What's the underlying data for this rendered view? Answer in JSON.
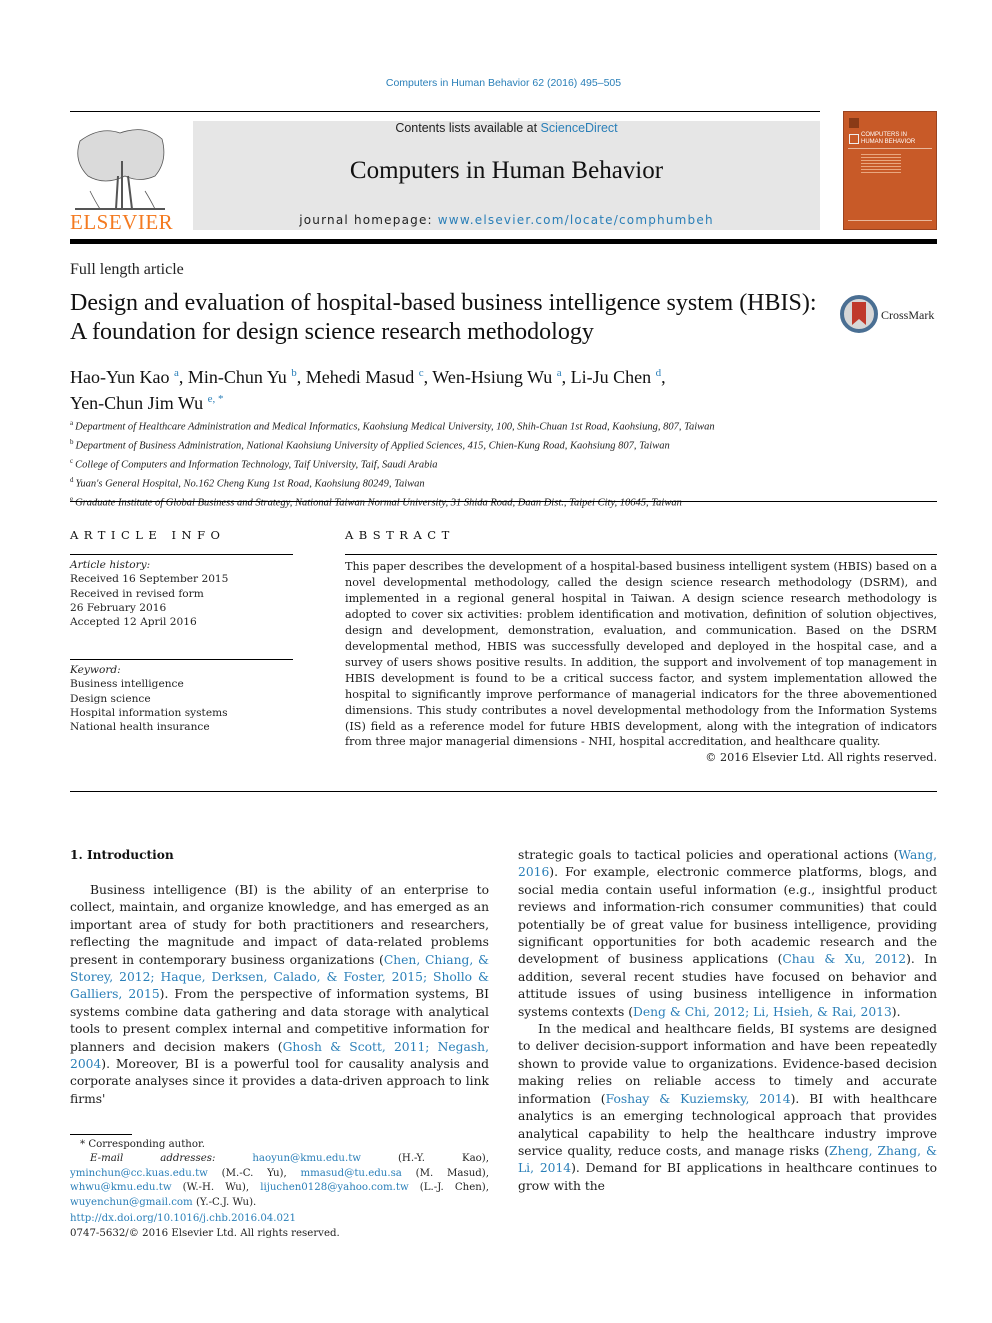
{
  "header": {
    "journal_reference": "Computers in Human Behavior 62 (2016) 495–505",
    "contents_prefix": "Contents lists available at ",
    "contents_link": "ScienceDirect",
    "journal_title": "Computers in Human Behavior",
    "homepage_prefix": "journal homepage: ",
    "homepage_link": "www.elsevier.com/locate/comphumbeh",
    "publisher_logo_text": "ELSEVIER",
    "cover_title_line1": "COMPUTERS IN",
    "cover_title_line2": "HUMAN BEHAVIOR",
    "colors": {
      "link": "#2a7fb8",
      "elsevier_orange": "#f47a20",
      "cover_orange": "#c85a28",
      "banner_bg": "#e6e6e6"
    }
  },
  "article": {
    "type": "Full length article",
    "title": "Design and evaluation of hospital-based business intelligence system (HBIS): A foundation for design science research methodology",
    "crossmark_label": "CrossMark",
    "authors": [
      {
        "name": "Hao-Yun Kao",
        "sup": "a",
        "sep": ", "
      },
      {
        "name": "Min-Chun Yu",
        "sup": "b",
        "sep": ", "
      },
      {
        "name": "Mehedi Masud",
        "sup": "c",
        "sep": ", "
      },
      {
        "name": "Wen-Hsiung Wu",
        "sup": "a",
        "sep": ", "
      },
      {
        "name": "Li-Ju Chen",
        "sup": "d",
        "sep": ","
      },
      {
        "name": "Yen-Chun Jim Wu",
        "sup": "e, *",
        "sep": ""
      }
    ],
    "affiliations": [
      {
        "key": "a",
        "text": "Department of Healthcare Administration and Medical Informatics, Kaohsiung Medical University, 100, Shih-Chuan 1st Road, Kaohsiung, 807, Taiwan"
      },
      {
        "key": "b",
        "text": "Department of Business Administration, National Kaohsiung University of Applied Sciences, 415, Chien-Kung Road, Kaohsiung 807, Taiwan"
      },
      {
        "key": "c",
        "text": "College of Computers and Information Technology, Taif University, Taif, Saudi Arabia"
      },
      {
        "key": "d",
        "text": "Yuan's General Hospital, No.162 Cheng Kung 1st Road, Kaohsiung 80249, Taiwan"
      },
      {
        "key": "e",
        "text": "Graduate Institute of Global Business and Strategy, National Taiwan Normal University, 31 Shida Road, Daan Dist., Taipei City, 10645, Taiwan"
      }
    ]
  },
  "article_info": {
    "heading": "ARTICLE INFO",
    "history_label": "Article history:",
    "history": [
      "Received 16 September 2015",
      "Received in revised form",
      "26 February 2016",
      "Accepted 12 April 2016"
    ],
    "keyword_label": "Keyword:",
    "keywords": [
      "Business intelligence",
      "Design science",
      "Hospital information systems",
      "National health insurance"
    ]
  },
  "abstract": {
    "heading": "ABSTRACT",
    "text": "This paper describes the development of a hospital-based business intelligent system (HBIS) based on a novel developmental methodology, called the design science research methodology (DSRM), and implemented in a regional general hospital in Taiwan. A design science research methodology is adopted to cover six activities: problem identification and motivation, definition of solution objectives, design and development, demonstration, evaluation, and communication. Based on the DSRM developmental method, HBIS was successfully developed and deployed in the hospital case, and a survey of users shows positive results. In addition, the support and involvement of top management in HBIS development is found to be a critical success factor, and system implementation allowed the hospital to significantly improve performance of managerial indicators for the three abovementioned dimensions. This study contributes a novel developmental methodology from the Information Systems (IS) field as a reference model for future HBIS development, along with the integration of indicators from three major managerial dimensions - NHI, hospital accreditation, and healthcare quality.",
    "copyright": "© 2016 Elsevier Ltd. All rights reserved."
  },
  "body": {
    "section_heading": "1.  Introduction",
    "left_paragraph": [
      {
        "t": "Business intelligence (BI) is the ability of an enterprise to collect, maintain, and organize knowledge, and has emerged as an important area of study for both practitioners and researchers, reflecting the magnitude and impact of data-related problems present in contemporary business organizations ("
      },
      {
        "link": "Chen, Chiang, & Storey, 2012; Haque, Derksen, Calado, & Foster, 2015; Shollo & Galliers, 2015"
      },
      {
        "t": "). From the perspective of information systems, BI systems combine data gathering and data storage with analytical tools to present complex internal and competitive information for planners and decision makers ("
      },
      {
        "link": "Ghosh & Scott, 2011; Negash, 2004"
      },
      {
        "t": "). Moreover, BI is a powerful tool for causality analysis and corporate analyses since it provides a data-driven approach to link firms'"
      }
    ],
    "right_paragraph_1": [
      {
        "t": "strategic goals to tactical policies and operational actions ("
      },
      {
        "link": "Wang, 2016"
      },
      {
        "t": "). For example, electronic commerce platforms, blogs, and social media contain useful information (e.g., insightful product reviews and information-rich consumer communities) that could potentially be of great value for business intelligence, providing significant opportunities for both academic research and the development of business applications ("
      },
      {
        "link": "Chau & Xu, 2012"
      },
      {
        "t": "). In addition, several recent studies have focused on behavior and attitude issues of using business intelligence in information systems contexts ("
      },
      {
        "link": "Deng & Chi, 2012; Li, Hsieh, & Rai, 2013"
      },
      {
        "t": ")."
      }
    ],
    "right_paragraph_2": [
      {
        "t": "In the medical and healthcare fields, BI systems are designed to deliver decision-support information and have been repeatedly shown to provide value to organizations. Evidence-based decision making relies on reliable access to timely and accurate information ("
      },
      {
        "link": "Foshay & Kuziemsky, 2014"
      },
      {
        "t": "). BI with healthcare analytics is an emerging technological approach that provides analytical capability to help the healthcare industry improve service quality, reduce costs, and manage risks ("
      },
      {
        "link": "Zheng, Zhang, & Li, 2014"
      },
      {
        "t": "). Demand for BI applications in healthcare continues to grow with the"
      }
    ]
  },
  "footnotes": {
    "corresponding": "* Corresponding author.",
    "email_label": "E-mail addresses: ",
    "emails": [
      {
        "email": "haoyun@kmu.edu.tw",
        "who": " (H.-Y. Kao), "
      },
      {
        "email": "yminchun@cc.kuas.edu.tw",
        "who": " (M.-C. Yu), "
      },
      {
        "email": "mmasud@tu.edu.sa",
        "who": " (M. Masud), "
      },
      {
        "email": "whwu@kmu.edu.tw",
        "who": " (W.-H. Wu), "
      },
      {
        "email": "lijuchen0128@yahoo.com.tw",
        "who": " (L.-J. Chen), "
      },
      {
        "email": "wuyenchun@gmail.com",
        "who": " (Y.-C.J. Wu)."
      }
    ],
    "doi": "http://dx.doi.org/10.1016/j.chb.2016.04.021",
    "issn_copyright": "0747-5632/© 2016 Elsevier Ltd. All rights reserved."
  }
}
